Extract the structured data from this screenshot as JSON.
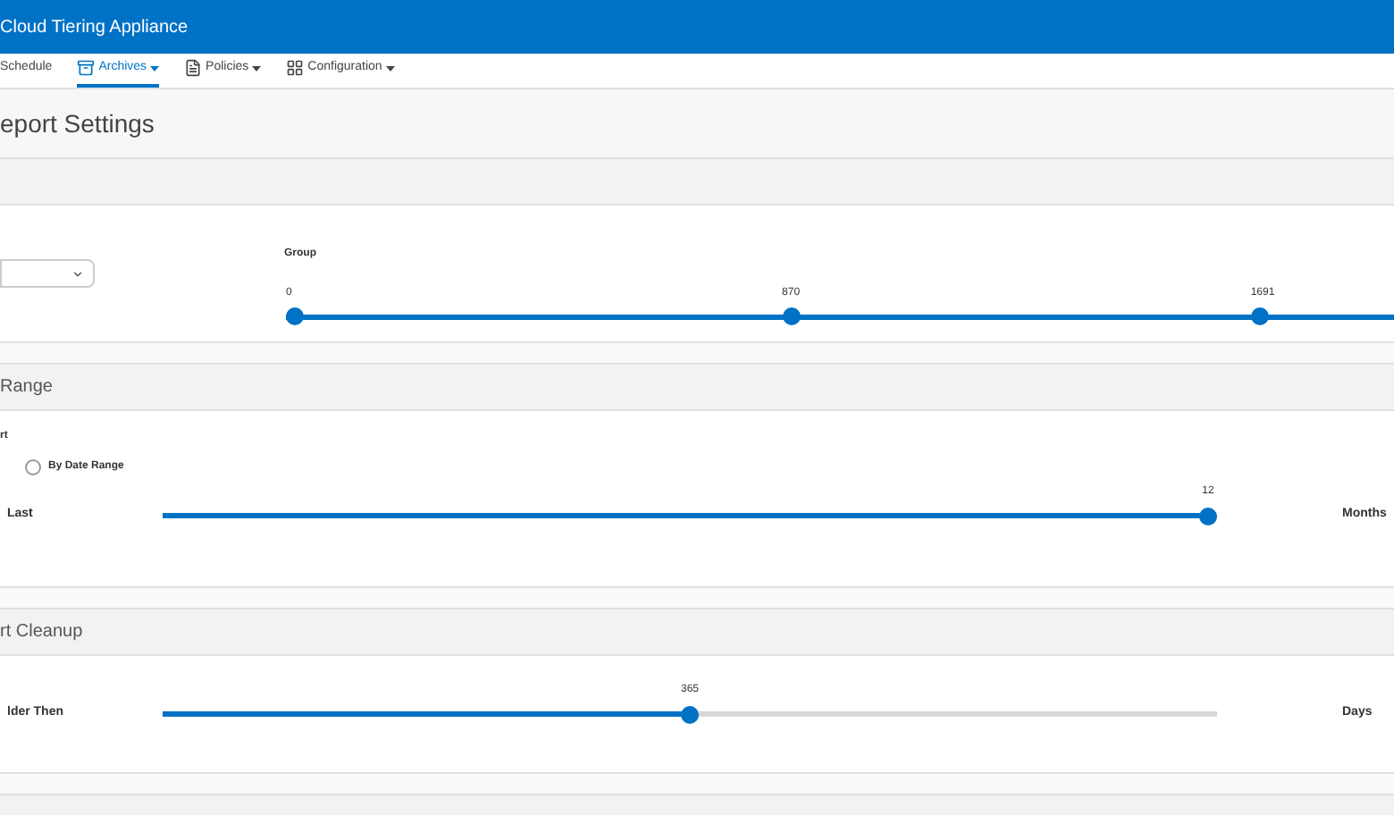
{
  "header": {
    "title": "Cloud Tiering Appliance"
  },
  "nav": [
    {
      "label": "Schedule",
      "kind": "plain",
      "dropdown": false,
      "selected": false
    },
    {
      "label": "Archives",
      "kind": "archive",
      "dropdown": true,
      "selected": true
    },
    {
      "label": "Policies",
      "kind": "document",
      "dropdown": true,
      "selected": false
    },
    {
      "label": "Configuration",
      "kind": "config",
      "dropdown": true,
      "selected": false
    }
  ],
  "page_title": "eport Settings",
  "group_section": {
    "label": "Group",
    "thumbs": [
      {
        "reading": "0",
        "level": 0
      },
      {
        "reading": "870",
        "level": 0.455
      },
      {
        "reading": "1691",
        "level": 0.885
      }
    ]
  },
  "range_section": {
    "title": "Range",
    "label": "rt",
    "radio": {
      "label": "By Date Range",
      "selected": false
    },
    "slider": {
      "label": "Last",
      "reading": "12",
      "level": 1,
      "unit": "Months"
    }
  },
  "cleanup_section": {
    "title": "rt Cleanup",
    "slider": {
      "label": "lder Then",
      "reading": "365",
      "level": 0.5,
      "unit": "Days"
    }
  }
}
